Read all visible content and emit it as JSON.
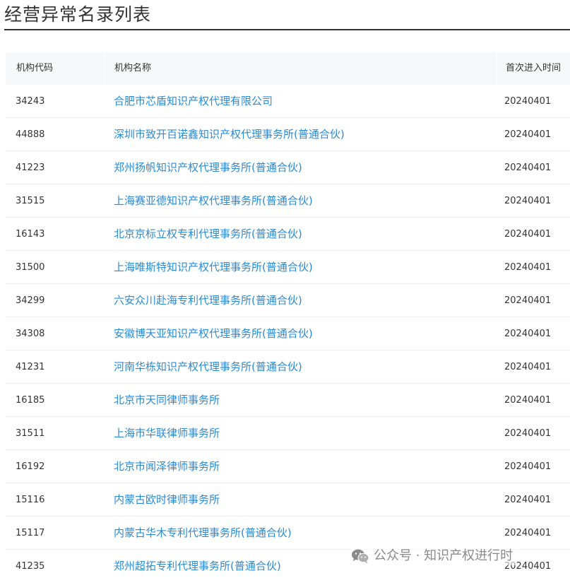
{
  "page": {
    "title": "经营异常名录列表"
  },
  "table": {
    "headers": {
      "code": "机构代码",
      "name": "机构名称",
      "date": "首次进入时间"
    },
    "rows": [
      {
        "code": "34243",
        "name": "合肥市芯盾知识产权代理有限公司",
        "date": "20240401"
      },
      {
        "code": "44888",
        "name": "深圳市致开百诺鑫知识产权代理事务所(普通合伙)",
        "date": "20240401"
      },
      {
        "code": "41223",
        "name": "郑州扬帆知识产权代理事务所(普通合伙)",
        "date": "20240401"
      },
      {
        "code": "31515",
        "name": "上海赛亚德知识产权代理事务所(普通合伙)",
        "date": "20240401"
      },
      {
        "code": "16143",
        "name": "北京京标立权专利代理事务所(普通合伙)",
        "date": "20240401"
      },
      {
        "code": "31500",
        "name": "上海唯斯特知识产权代理事务所(普通合伙)",
        "date": "20240401"
      },
      {
        "code": "34299",
        "name": "六安众川赴海专利代理事务所(普通合伙)",
        "date": "20240401"
      },
      {
        "code": "34308",
        "name": "安徽博天亚知识产权代理事务所(普通合伙)",
        "date": "20240401"
      },
      {
        "code": "41231",
        "name": "河南华栋知识产权代理事务所(普通合伙)",
        "date": "20240401"
      },
      {
        "code": "16185",
        "name": "北京市天同律师事务所",
        "date": "20240401"
      },
      {
        "code": "31511",
        "name": "上海市华联律师事务所",
        "date": "20240401"
      },
      {
        "code": "16192",
        "name": "北京市闻泽律师事务所",
        "date": "20240401"
      },
      {
        "code": "15116",
        "name": "内蒙古欧时律师事务所",
        "date": "20240401"
      },
      {
        "code": "15117",
        "name": "内蒙古华木专利代理事务所(普通合伙)",
        "date": "20240401"
      },
      {
        "code": "41235",
        "name": "郑州超拓专利代理事务所(普通合伙)",
        "date": "20240401"
      }
    ]
  },
  "watermark": {
    "text": "公众号 · 知识产权进行时",
    "icon": "wechat-icon"
  },
  "colors": {
    "link": "#2a8bd4",
    "header_bg": "#f7f8fa",
    "text": "#333333"
  }
}
